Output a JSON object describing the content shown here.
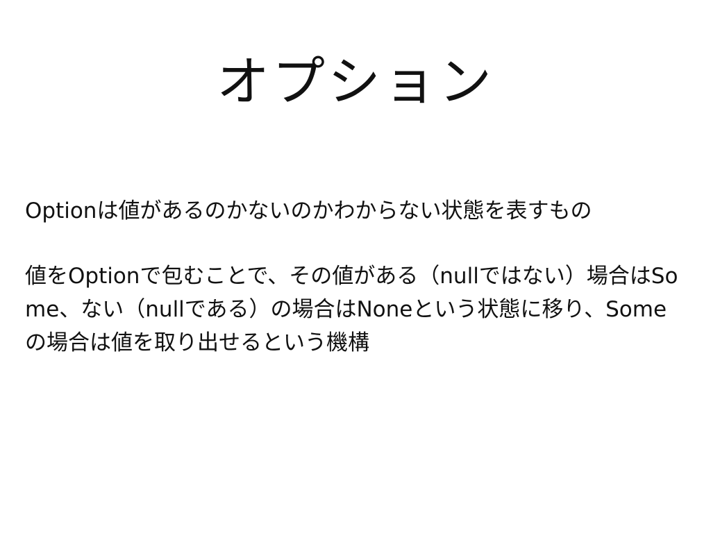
{
  "slide": {
    "title": "オプション",
    "paragraphs": [
      "Optionは値があるのかないのかわからない状態を表すもの",
      "値をOptionで包むことで、その値がある（nullではない）場合はSome、ない（nullである）の場合はNoneという状態に移り、Someの場合は値を取り出せるという機構"
    ]
  }
}
